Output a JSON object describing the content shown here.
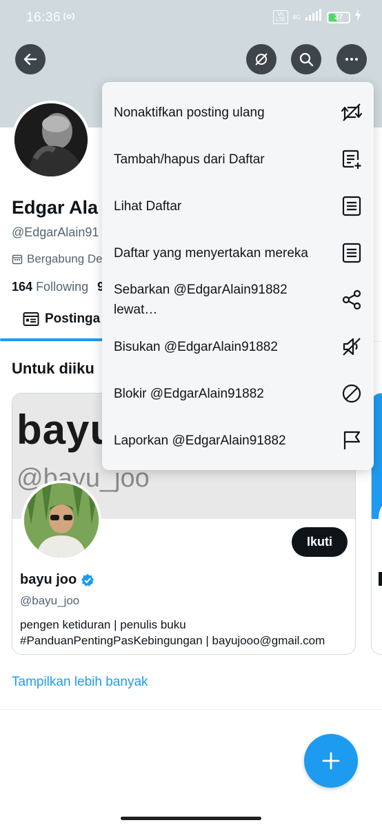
{
  "status_bar": {
    "time": "16:36",
    "volte": "Vo LTE",
    "network": "4G",
    "battery": "37"
  },
  "header": {
    "back_icon": "arrow-left-icon",
    "repost_off_icon": "repost-off-icon",
    "search_icon": "search-icon",
    "more_icon": "more-icon"
  },
  "profile": {
    "name": "Edgar Ala",
    "handle": "@EdgarAlain91",
    "joined": "Bergabung De",
    "following_count": "164",
    "following_label": "Following",
    "followers_partial": "9"
  },
  "tabs": {
    "posts": "Postinga"
  },
  "suggestions": {
    "title": "Untuk diiku",
    "card": {
      "banner_text_1": "bayu",
      "banner_text_2": "@bayu_joo",
      "name": "bayu joo",
      "handle": "@bayu_joo",
      "follow_label": "Ikuti",
      "bio_line_1": "pengen ketiduran | penulis buku",
      "bio_line_2": "#PanduanPentingPasKebingungan | bayujooo@gmail.com"
    },
    "show_more": "Tampilkan lebih banyak"
  },
  "menu": {
    "items": [
      {
        "label": "Nonaktifkan posting ulang",
        "icon": "repost-off-icon"
      },
      {
        "label": "Tambah/hapus dari Daftar",
        "icon": "list-add-icon"
      },
      {
        "label": "Lihat Daftar",
        "icon": "list-icon"
      },
      {
        "label": "Daftar yang menyertakan mereka",
        "icon": "list-icon"
      },
      {
        "label": "Sebarkan @EdgarAlain91882 lewat…",
        "icon": "share-icon"
      },
      {
        "label": "Bisukan @EdgarAlain91882",
        "icon": "mute-icon"
      },
      {
        "label": "Blokir @EdgarAlain91882",
        "icon": "block-icon"
      },
      {
        "label": "Laporkan @EdgarAlain91882",
        "icon": "flag-icon"
      }
    ]
  },
  "colors": {
    "accent": "#1d9bf0",
    "banner": "#cfd9de",
    "text_primary": "#0f1419",
    "text_secondary": "#536471",
    "menu_bg": "#f5f6f7"
  }
}
